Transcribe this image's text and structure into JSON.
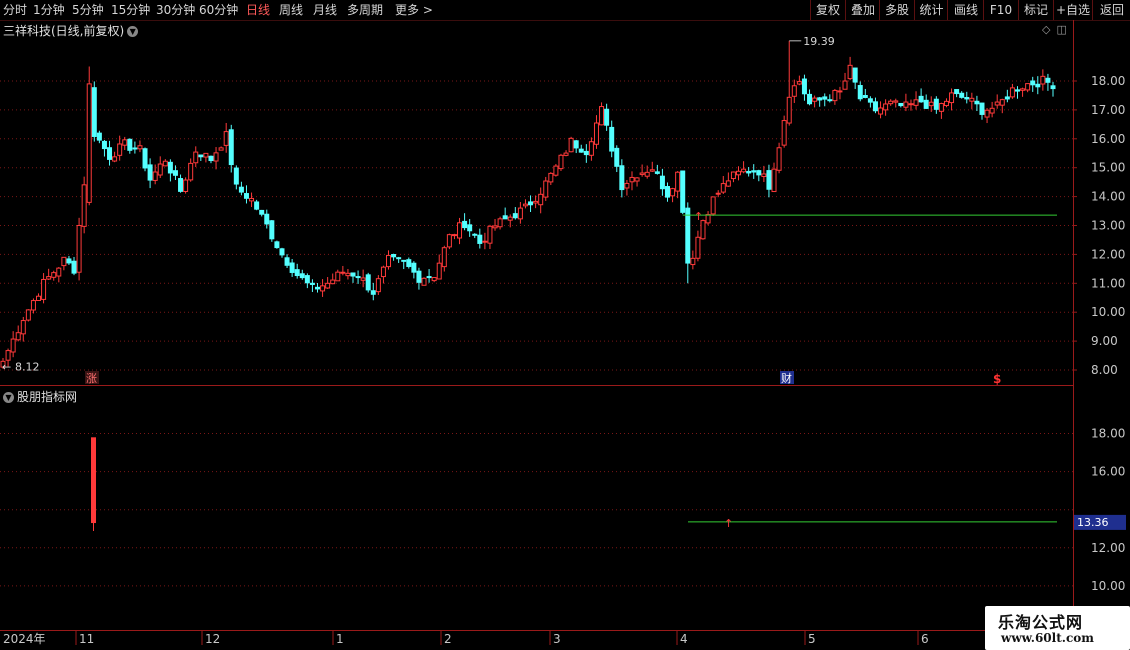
{
  "toolbar": {
    "periods": [
      {
        "label": "分时",
        "active": false
      },
      {
        "label": "1分钟",
        "active": false
      },
      {
        "label": "5分钟",
        "active": false
      },
      {
        "label": "15分钟",
        "active": false
      },
      {
        "label": "30分钟",
        "active": false
      },
      {
        "label": "60分钟",
        "active": false
      },
      {
        "label": "日线",
        "active": true
      },
      {
        "label": "周线",
        "active": false
      },
      {
        "label": "月线",
        "active": false
      },
      {
        "label": "多周期",
        "active": false
      },
      {
        "label": "更多 >",
        "active": false
      }
    ],
    "tools": [
      "复权",
      "叠加",
      "多股",
      "统计",
      "画线",
      "F10",
      "标记",
      "+自选",
      "返回"
    ]
  },
  "chart_title": "三祥科技(日线,前复权)",
  "indicator_title": "股朋指标网",
  "colors": {
    "up": "#ff3a3a",
    "down": "#54ffff",
    "signal_line": "#33cc33",
    "grid": "#7a1717",
    "axis_text": "#c8c8c8",
    "badge_bg": "#1f2f8f"
  },
  "main_axis": {
    "ticks": [
      "18.00",
      "17.00",
      "16.00",
      "15.00",
      "14.00",
      "13.00",
      "12.00",
      "11.00",
      "10.00",
      "9.00",
      "8.00"
    ]
  },
  "indicator_axis": {
    "ticks": [
      "18.00",
      "16.00",
      "12.00",
      "10.00"
    ],
    "badge": "13.36"
  },
  "annotations": {
    "high_label": "19.39",
    "low_label": "8.12",
    "marker_zhang": "涨",
    "marker_cai": "财",
    "marker_dollar": "$"
  },
  "x_axis": {
    "labels": [
      "2024年",
      "11",
      "12",
      "1",
      "2",
      "3",
      "4",
      "5",
      "6"
    ]
  },
  "watermark": {
    "title": "乐淘公式网",
    "url": "www.60lt.com"
  },
  "chart_data": {
    "type": "candlestick",
    "title": "三祥科技(日线,前复权)",
    "x_labels": [
      "2024年",
      "11",
      "12",
      "1",
      "2",
      "3",
      "4",
      "5",
      "6"
    ],
    "y_range": [
      7.8,
      19.9
    ],
    "y_ticks": [
      8,
      9,
      10,
      11,
      12,
      13,
      14,
      15,
      16,
      17,
      18
    ],
    "max_marker": 19.39,
    "min_marker": 8.12,
    "grid": true,
    "anchors": [
      {
        "i": 0,
        "c": 8.3
      },
      {
        "i": 4,
        "c": 9.8
      },
      {
        "i": 8,
        "c": 11.0
      },
      {
        "i": 12,
        "c": 11.8
      },
      {
        "i": 14,
        "c": 11.5
      },
      {
        "i": 16,
        "c": 14.5
      },
      {
        "i": 17,
        "c": 17.8
      },
      {
        "i": 18,
        "c": 16.2
      },
      {
        "i": 21,
        "c": 15.4
      },
      {
        "i": 24,
        "c": 15.8
      },
      {
        "i": 27,
        "c": 15.6
      },
      {
        "i": 29,
        "c": 14.6
      },
      {
        "i": 32,
        "c": 15.3
      },
      {
        "i": 35,
        "c": 14.2
      },
      {
        "i": 38,
        "c": 15.6
      },
      {
        "i": 41,
        "c": 15.3
      },
      {
        "i": 44,
        "c": 16.1
      },
      {
        "i": 46,
        "c": 14.3
      },
      {
        "i": 49,
        "c": 13.9
      },
      {
        "i": 52,
        "c": 13.0
      },
      {
        "i": 55,
        "c": 12.0
      },
      {
        "i": 58,
        "c": 11.3
      },
      {
        "i": 61,
        "c": 10.8
      },
      {
        "i": 64,
        "c": 11.0
      },
      {
        "i": 67,
        "c": 11.4
      },
      {
        "i": 70,
        "c": 11.3
      },
      {
        "i": 73,
        "c": 10.7
      },
      {
        "i": 76,
        "c": 11.8
      },
      {
        "i": 79,
        "c": 11.7
      },
      {
        "i": 82,
        "c": 11.2
      },
      {
        "i": 85,
        "c": 11.3
      },
      {
        "i": 88,
        "c": 12.6
      },
      {
        "i": 91,
        "c": 13.1
      },
      {
        "i": 94,
        "c": 12.4
      },
      {
        "i": 97,
        "c": 13.0
      },
      {
        "i": 100,
        "c": 13.3
      },
      {
        "i": 103,
        "c": 13.6
      },
      {
        "i": 106,
        "c": 14.2
      },
      {
        "i": 109,
        "c": 15.0
      },
      {
        "i": 112,
        "c": 15.9
      },
      {
        "i": 115,
        "c": 15.6
      },
      {
        "i": 118,
        "c": 17.0
      },
      {
        "i": 120,
        "c": 15.7
      },
      {
        "i": 122,
        "c": 14.4
      },
      {
        "i": 125,
        "c": 14.8
      },
      {
        "i": 128,
        "c": 15.0
      },
      {
        "i": 131,
        "c": 14.1
      },
      {
        "i": 133,
        "c": 14.8
      },
      {
        "i": 134,
        "c": 13.6
      },
      {
        "i": 135,
        "c": 11.7
      },
      {
        "i": 136,
        "c": 12.0
      },
      {
        "i": 138,
        "c": 13.2
      },
      {
        "i": 140,
        "c": 13.9
      },
      {
        "i": 143,
        "c": 14.6
      },
      {
        "i": 146,
        "c": 14.9
      },
      {
        "i": 149,
        "c": 14.9
      },
      {
        "i": 151,
        "c": 14.4
      },
      {
        "i": 153,
        "c": 15.8
      },
      {
        "i": 155,
        "c": 17.6
      },
      {
        "i": 157,
        "c": 18.0
      },
      {
        "i": 159,
        "c": 17.2
      },
      {
        "i": 162,
        "c": 17.4
      },
      {
        "i": 165,
        "c": 17.6
      },
      {
        "i": 167,
        "c": 18.4
      },
      {
        "i": 169,
        "c": 17.4
      },
      {
        "i": 172,
        "c": 17.0
      },
      {
        "i": 175,
        "c": 17.2
      },
      {
        "i": 178,
        "c": 17.1
      },
      {
        "i": 181,
        "c": 17.3
      },
      {
        "i": 184,
        "c": 17.0
      },
      {
        "i": 187,
        "c": 17.5
      },
      {
        "i": 190,
        "c": 17.4
      },
      {
        "i": 193,
        "c": 17.0
      },
      {
        "i": 196,
        "c": 17.1
      },
      {
        "i": 199,
        "c": 17.7
      },
      {
        "i": 202,
        "c": 17.9
      },
      {
        "i": 205,
        "c": 18.0
      },
      {
        "i": 207,
        "c": 17.9
      }
    ],
    "signal_line": {
      "value": 13.36,
      "from_candle": 134,
      "label": "13.36"
    },
    "signal_bar": {
      "candle": 17,
      "low": 13.3,
      "high": 17.8
    }
  }
}
